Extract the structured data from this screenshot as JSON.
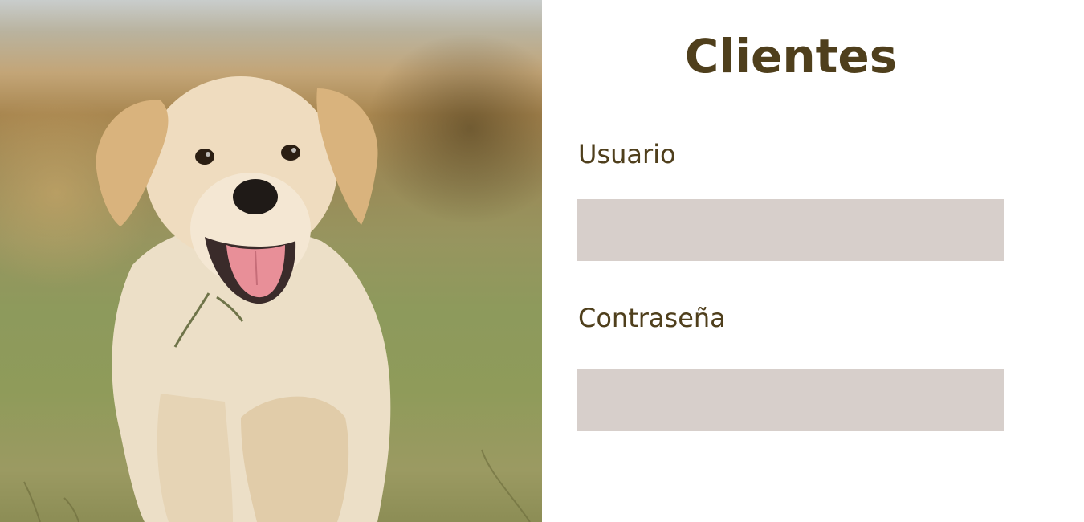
{
  "hero": {
    "image_icon": "golden-retriever-puppy-photo"
  },
  "form": {
    "title": "Clientes",
    "username_label": "Usuario",
    "username_value": "",
    "password_label": "Contraseña",
    "password_value": ""
  },
  "colors": {
    "text_brown": "#4f3f1c",
    "field_background": "#d7cfcb",
    "panel_background": "#ffffff"
  }
}
